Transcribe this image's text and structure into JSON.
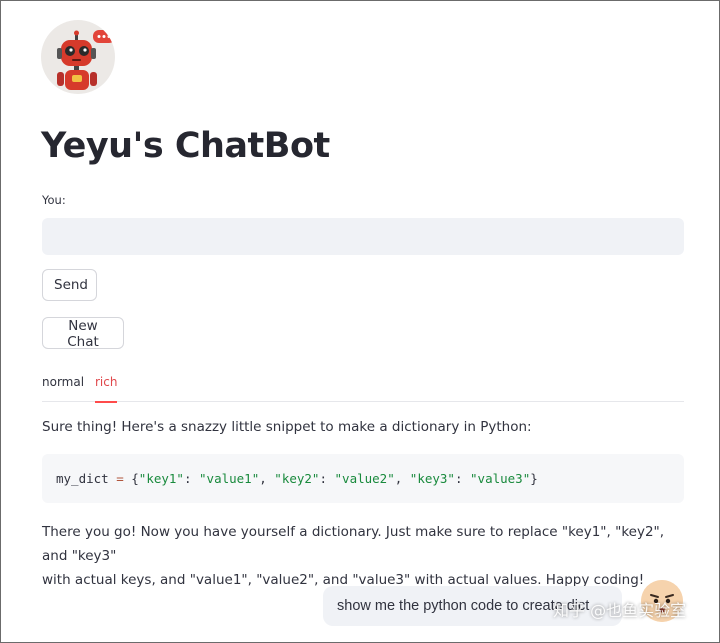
{
  "app": {
    "title": "Yeyu's ChatBot"
  },
  "input": {
    "label": "You:",
    "value": "",
    "placeholder": ""
  },
  "buttons": {
    "send": "Send",
    "new_chat": "New Chat"
  },
  "tabs": [
    {
      "label": "normal",
      "active": false
    },
    {
      "label": "rich",
      "active": true
    }
  ],
  "response": {
    "intro": "Sure thing! Here's a snazzy little snippet to make a dictionary in Python:",
    "code": {
      "var": "my_dict",
      "assign": " = ",
      "open": "{",
      "k1": "\"key1\"",
      "v1": "\"value1\"",
      "k2": "\"key2\"",
      "v2": "\"value2\"",
      "k3": "\"key3\"",
      "v3": "\"value3\"",
      "colon": ": ",
      "comma": ", ",
      "close": "}"
    },
    "line1": "There you go! Now you have yourself a dictionary. Just make sure to replace \"key1\", \"key2\", and \"key3\"",
    "line2": "with actual keys, and \"value1\", \"value2\", and \"value3\" with actual values. Happy coding!"
  },
  "user_message": {
    "text": "show me the python code to create dict"
  },
  "watermark": "知乎 @也鱼实验室",
  "colors": {
    "accent": "#ff4b4b",
    "bot_avatar": "#d63a2b",
    "code_string": "#198a3d",
    "input_bg": "#f0f2f6"
  },
  "icons": {
    "bot_avatar": "robot-icon",
    "user_avatar": "face-icon"
  }
}
